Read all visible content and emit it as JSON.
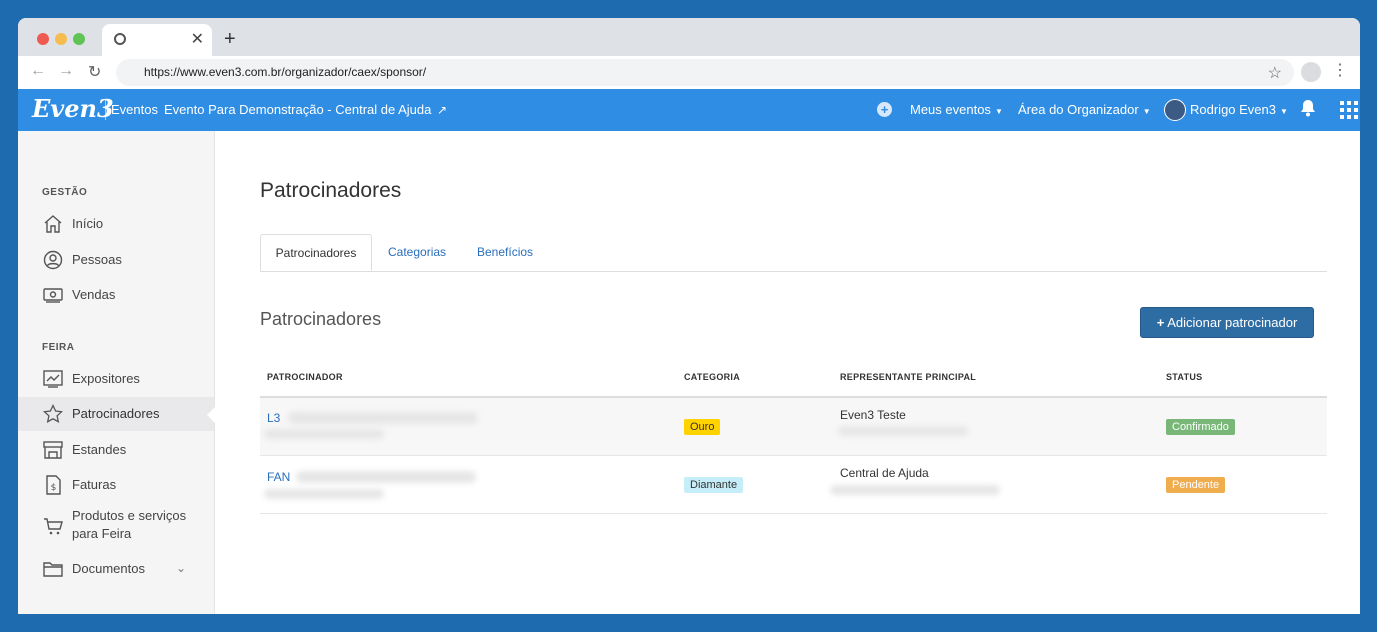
{
  "browser": {
    "url": "https://www.even3.com.br/organizador/caex/sponsor/",
    "traffic_colors": [
      "#ee5a52",
      "#f5bd4f",
      "#5fc454"
    ]
  },
  "appbar": {
    "logo": "Even3",
    "section": "Eventos",
    "event_name": "Evento Para Demonstração - Central de Ajuda",
    "menu_meus_eventos": "Meus eventos",
    "menu_area": "Área do Organizador",
    "user_name": "Rodrigo Even3"
  },
  "sidebar": {
    "gestao_label": "GESTÃO",
    "feira_label": "FEIRA",
    "items": [
      {
        "label": "Início",
        "icon": "home-icon"
      },
      {
        "label": "Pessoas",
        "icon": "user-circle-icon"
      },
      {
        "label": "Vendas",
        "icon": "ticket-icon"
      },
      {
        "label": "Expositores",
        "icon": "chart-icon"
      },
      {
        "label": "Patrocinadores",
        "icon": "star-icon"
      },
      {
        "label": "Estandes",
        "icon": "store-icon"
      },
      {
        "label": "Faturas",
        "icon": "invoice-icon"
      },
      {
        "label": "Produtos e serviços para Feira",
        "icon": "cart-icon"
      },
      {
        "label": "Documentos",
        "icon": "folder-icon"
      }
    ]
  },
  "main": {
    "page_title": "Patrocinadores",
    "tabs": [
      "Patrocinadores",
      "Categorias",
      "Benefícios"
    ],
    "section_title": "Patrocinadores",
    "add_button": "Adicionar patrocinador",
    "table": {
      "headers": [
        "PATROCINADOR",
        "CATEGORIA",
        "REPRESENTANTE PRINCIPAL",
        "STATUS"
      ],
      "rows": [
        {
          "sponsor": "L3",
          "category": "Ouro",
          "category_color": "#ffd200",
          "representative": "Even3 Teste",
          "status": "Confirmado",
          "status_color": "#79b779"
        },
        {
          "sponsor": "FAN",
          "category": "Diamante",
          "category_color": "#c6eef8",
          "representative": "Central de Ajuda",
          "status": "Pendente",
          "status_color": "#f0ad4e"
        }
      ]
    }
  }
}
